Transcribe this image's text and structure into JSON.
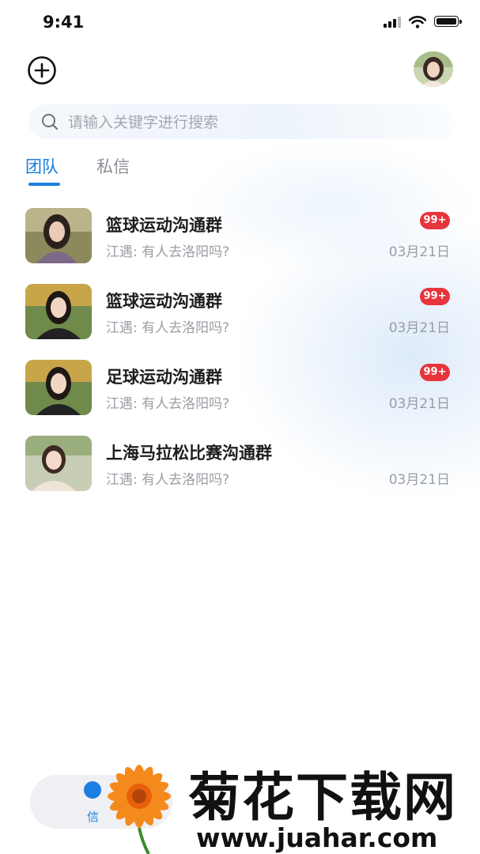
{
  "status_bar": {
    "time": "9:41"
  },
  "search": {
    "placeholder": "请输入关键字进行搜索"
  },
  "tabs": [
    {
      "label": "团队",
      "active": true
    },
    {
      "label": "私信",
      "active": false
    }
  ],
  "conversations": [
    {
      "title": "篮球运动沟通群",
      "preview": "江遇:  有人去洛阳吗?",
      "date": "03月21日",
      "badge": "99+"
    },
    {
      "title": "篮球运动沟通群",
      "preview": "江遇:  有人去洛阳吗?",
      "date": "03月21日",
      "badge": "99+"
    },
    {
      "title": "足球运动沟通群",
      "preview": "江遇:  有人去洛阳吗?",
      "date": "03月21日",
      "badge": "99+"
    },
    {
      "title": "上海马拉松比赛沟通群",
      "preview": "江遇:  有人去洛阳吗?",
      "date": "03月21日",
      "badge": ""
    }
  ],
  "bottom_nav": {
    "label": "信"
  },
  "watermark": {
    "title": "菊花下载网",
    "url": "www.juahar.com"
  },
  "colors": {
    "accent": "#1a7fe0",
    "badge": "#e8343c",
    "muted_text": "#9a9ea4"
  }
}
